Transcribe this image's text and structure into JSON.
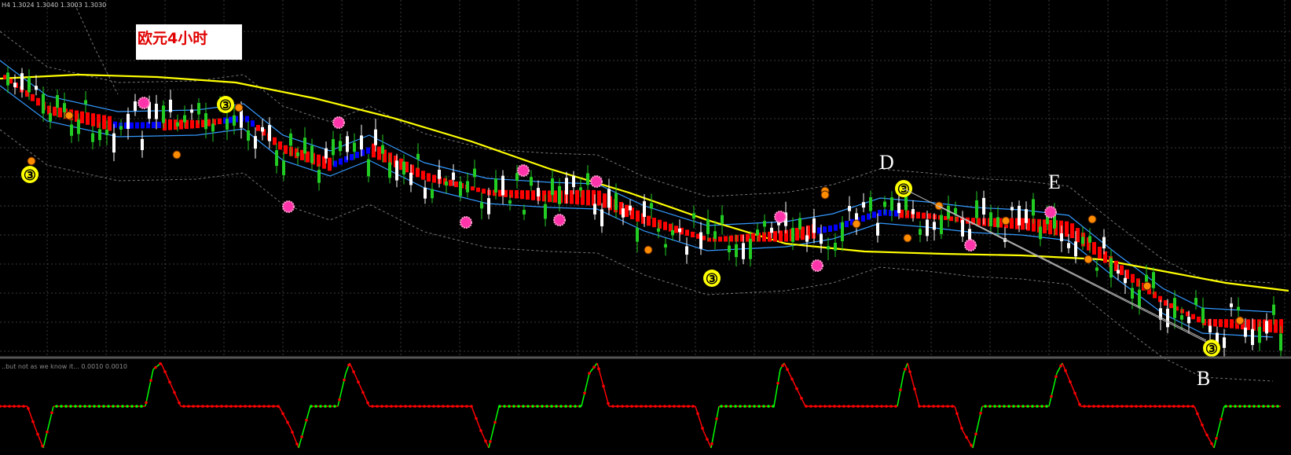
{
  "header": {
    "symbol_info": "H4  1.3024 1.3040 1.3003 1.3030",
    "sub_info": "..but not as we know it...  0.0010 0.0010"
  },
  "title": "欧元4小时",
  "wave_labels": {
    "D": "D",
    "E": "E",
    "B": "B"
  },
  "colors": {
    "background": "#000000",
    "grid": "#3a3a3a",
    "bull_candle": "#ffffff",
    "bear_candle": "#22cc22",
    "ribbon_down": "#ff0000",
    "ribbon_up": "#0000ff",
    "ma_long": "#ffff00",
    "band": "#3399ff",
    "envelope": "#777777",
    "osc_up": "#00ff00",
    "osc_down": "#ff0000",
    "marker_3": "#ffff00",
    "marker_1": "#ff8c00",
    "marker_flower": "#ff33aa"
  },
  "chart_data": {
    "type": "line",
    "timeframe": "H4",
    "last_quote": {
      "open": 1.3024,
      "high": 1.304,
      "low": 1.3003,
      "close": 1.303
    },
    "oscillator_levels": [
      0.001,
      0.001
    ],
    "grid": true,
    "legend": "none"
  }
}
